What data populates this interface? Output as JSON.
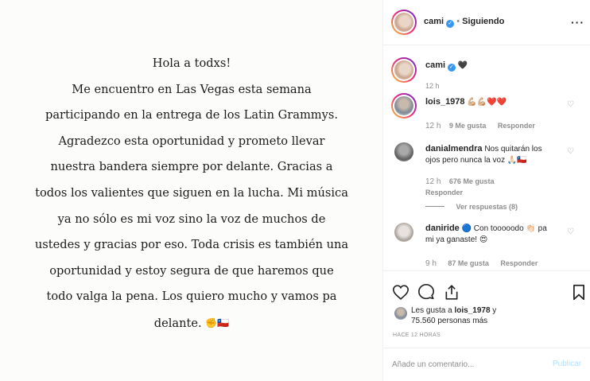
{
  "post": {
    "lines": [
      "Hola a todxs!",
      "Me encuentro en Las Vegas esta semana",
      "participando en la entrega de los Latin Grammys.",
      "Agradezco esta oportunidad y prometo llevar",
      "nuestra bandera siempre por delante. Gracias a",
      "todos los valientes que siguen en la lucha. Mi música",
      "ya no sólo es mi voz sino la voz de muchos de",
      "ustedes y gracias por eso. Toda crisis es también una",
      "oportunidad y estoy segura de que haremos que",
      "todo valga la pena. Los quiero mucho y vamos pa",
      "delante."
    ],
    "last_line_emojis": "✊🇨🇱"
  },
  "header": {
    "username": "cami",
    "separator": "•",
    "follow_status": "Siguiendo",
    "more_icon": "more-horizontal-icon"
  },
  "caption": {
    "username": "cami",
    "text": "🖤",
    "time": "12 h"
  },
  "comments": [
    {
      "username": "lois_1978",
      "text": "💪🏼💪🏼❤️❤️",
      "time": "12 h",
      "likes": "9 Me gusta",
      "reply": "Responder"
    },
    {
      "username": "danialmendra",
      "text": "Nos quitarán los ojos pero nunca la voz 🙏🏻🇨🇱",
      "time": "12 h",
      "likes": "676 Me gusta",
      "reply": "Responder",
      "view_replies": "Ver respuestas (8)"
    },
    {
      "username": "daniride",
      "text": "🔵 Con tooooodo 👏🏻 pa mi ya ganaste! 😍",
      "time": "9 h",
      "likes": "87 Me gusta",
      "reply": "Responder"
    }
  ],
  "likes": {
    "prefix": "Les gusta a ",
    "user": "lois_1978",
    "connector": " y",
    "count": "75.560 personas más"
  },
  "timestamp": "HACE 12 HORAS",
  "composer": {
    "placeholder": "Añade un comentario...",
    "publish": "Publicar"
  },
  "colors": {
    "verified": "#3897f0",
    "publish_disabled": "#b2dffc",
    "muted": "#8e8e8e"
  }
}
